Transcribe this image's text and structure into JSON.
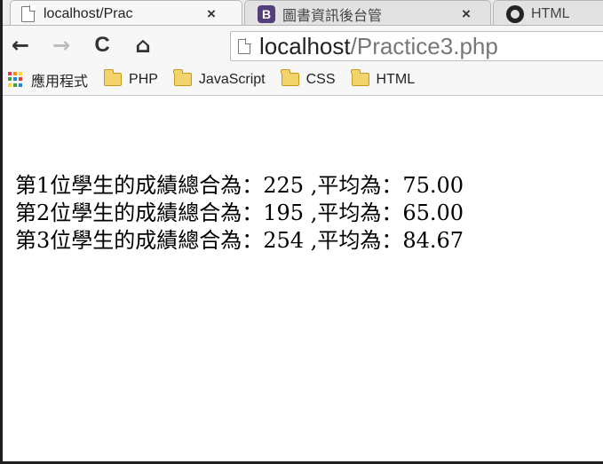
{
  "tabs": [
    {
      "title": "localhost/Prac",
      "close": "×",
      "icon": "document-icon",
      "active": true
    },
    {
      "title": "圖書資訊後台管",
      "close": "×",
      "icon": "bootstrap-icon",
      "icon_text": "B",
      "active": false
    },
    {
      "title": "HTML",
      "icon": "github-icon",
      "active": false
    }
  ],
  "toolbar": {
    "back": "←",
    "forward": "→",
    "reload": "C",
    "home": "⌂"
  },
  "address_bar": {
    "host": "localhost",
    "path": "/Practice3.php"
  },
  "bookmarks": [
    {
      "label": "應用程式",
      "icon": "apps-icon"
    },
    {
      "label": "PHP",
      "icon": "folder-icon"
    },
    {
      "label": "JavaScript",
      "icon": "folder-icon"
    },
    {
      "label": "CSS",
      "icon": "folder-icon"
    },
    {
      "label": "HTML",
      "icon": "folder-icon"
    }
  ],
  "page": {
    "lines": [
      "第1位學生的成績總合為：225 ,平均為：75.00",
      "第2位學生的成績總合為：195 ,平均為：65.00",
      "第3位學生的成績總合為：254 ,平均為：84.67"
    ]
  },
  "colors": {
    "bootstrap": "#563d7c",
    "folder": "#f3d36b"
  }
}
